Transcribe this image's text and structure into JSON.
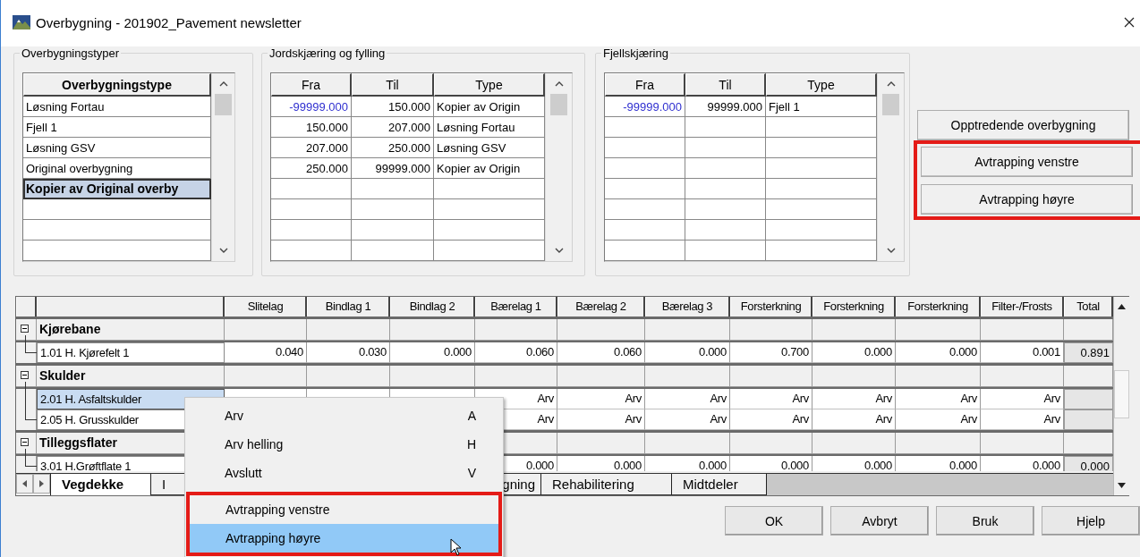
{
  "window": {
    "title": "Overbygning - 201902_Pavement newsletter"
  },
  "overbygningstyper": {
    "legend": "Overbygningstyper",
    "column": "Overbygningstype",
    "items": [
      {
        "label": "Løsning Fortau",
        "selected": false
      },
      {
        "label": "Fjell 1",
        "selected": false
      },
      {
        "label": "Løsning GSV",
        "selected": false
      },
      {
        "label": "Original overbygning",
        "selected": false
      },
      {
        "label": "Kopier av Original overby",
        "selected": true
      }
    ]
  },
  "jordskjaering": {
    "legend": "Jordskjæring og fylling",
    "columns": [
      "Fra",
      "Til",
      "Type"
    ],
    "rows": [
      {
        "fra": "-99999.000",
        "til": "150.000",
        "type": "Kopier av Origin",
        "color": "#3030d0"
      },
      {
        "fra": "150.000",
        "til": "207.000",
        "type": "Løsning Fortau",
        "color": "#000000"
      },
      {
        "fra": "207.000",
        "til": "250.000",
        "type": "Løsning GSV",
        "color": "#000000"
      },
      {
        "fra": "250.000",
        "til": "99999.000",
        "type": "Kopier av Origin",
        "color": "#000000"
      }
    ]
  },
  "fjellskjaering": {
    "legend": "Fjellskjæring",
    "columns": [
      "Fra",
      "Til",
      "Type"
    ],
    "rows": [
      {
        "fra": "-99999.000",
        "til": "99999.000",
        "type": "Fjell 1",
        "color": "#3030d0"
      }
    ]
  },
  "side_buttons": [
    {
      "label": "Opptredende overbygning",
      "framed": false
    },
    {
      "label": "Avtrapping venstre",
      "framed": true
    },
    {
      "label": "Avtrapping høyre",
      "framed": true
    }
  ],
  "layers": {
    "columns": [
      "Slitelag",
      "Bindlag 1",
      "Bindlag 2",
      "Bærelag 1",
      "Bærelag 2",
      "Bærelag 3",
      "Forsterkning",
      "Forsterkning",
      "Forsterkning",
      "Filter-/Frosts",
      "Total"
    ],
    "groups": [
      {
        "label": "Kjørebane",
        "expanded": true,
        "children": [
          {
            "label": "1.01 H. Kjørefelt 1",
            "selected": false,
            "values": [
              "0.040",
              "0.030",
              "0.000",
              "0.060",
              "0.060",
              "0.000",
              "0.700",
              "0.000",
              "0.000",
              "0.001"
            ],
            "total": "0.891"
          }
        ]
      },
      {
        "label": "Skulder",
        "expanded": true,
        "children": [
          {
            "label": "2.01 H. Asfaltskulder",
            "selected": true,
            "values": [
              "Arv",
              "Arv",
              "Arv",
              "Arv",
              "Arv",
              "Arv",
              "Arv"
            ]
          },
          {
            "label": "2.05 H. Grusskulder",
            "selected": false,
            "values": [
              "Arv",
              "Arv",
              "Arv",
              "Arv",
              "Arv",
              "Arv",
              "Arv"
            ]
          }
        ]
      },
      {
        "label": "Tilleggsflater",
        "expanded": true,
        "children": [
          {
            "label": "3.01 H.Grøftflate 1",
            "selected": false,
            "values": [
              "0.000",
              "0.000",
              "0.000",
              "0.000",
              "0.000",
              "0.000",
              "0.000"
            ],
            "total": "0.000"
          }
        ]
      }
    ]
  },
  "tabs": [
    {
      "label": "Vegdekke",
      "selected": true
    },
    {
      "label": "I",
      "selected": false
    },
    {
      "label": "gning",
      "selected": false
    },
    {
      "label": "Rehabilitering",
      "selected": false
    },
    {
      "label": "Midtdeler",
      "selected": false
    }
  ],
  "context_menu": {
    "items": [
      {
        "label": "Arv",
        "shortcut": "A",
        "framed": false,
        "selected": false
      },
      {
        "label": "Arv helling",
        "shortcut": "H",
        "framed": false,
        "selected": false
      },
      {
        "label": "Avslutt",
        "shortcut": "V",
        "framed": false,
        "selected": false
      },
      {
        "label": "Avtrapping venstre",
        "framed": true,
        "selected": false
      },
      {
        "label": "Avtrapping høyre",
        "framed": true,
        "selected": true
      }
    ]
  },
  "buttons": [
    "OK",
    "Avbryt",
    "Bruk",
    "Hjelp"
  ]
}
